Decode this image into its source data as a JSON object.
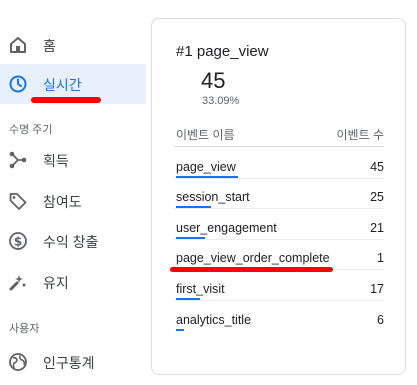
{
  "sidebar": {
    "items": [
      {
        "label": "홈",
        "icon": "home-icon"
      },
      {
        "label": "실시간",
        "icon": "clock-icon"
      }
    ],
    "section_lifecycle": "수명 주기",
    "lifecycle_items": [
      {
        "label": "획득",
        "icon": "acquisition-icon"
      },
      {
        "label": "참여도",
        "icon": "engagement-tag-icon"
      },
      {
        "label": "수익 창출",
        "icon": "dollar-icon"
      },
      {
        "label": "유지",
        "icon": "retention-icon"
      }
    ],
    "section_user": "사용자",
    "user_items": [
      {
        "label": "인구통계",
        "icon": "globe-icon"
      }
    ],
    "active_color": "#1a73e8"
  },
  "card": {
    "title": "#1 page_view",
    "value": "45",
    "percent": "33.09%",
    "header_event": "이벤트 이름",
    "header_count": "이벤트 수",
    "rows": [
      {
        "name": "page_view",
        "count": "45",
        "share": 1.0
      },
      {
        "name": "session_start",
        "count": "25",
        "share": 0.56
      },
      {
        "name": "user_engagement",
        "count": "21",
        "share": 0.47
      },
      {
        "name": "page_view_order_complete",
        "count": "1",
        "share": 0.02
      },
      {
        "name": "first_visit",
        "count": "17",
        "share": 0.38
      },
      {
        "name": "analytics_title",
        "count": "6",
        "share": 0.13
      }
    ]
  }
}
